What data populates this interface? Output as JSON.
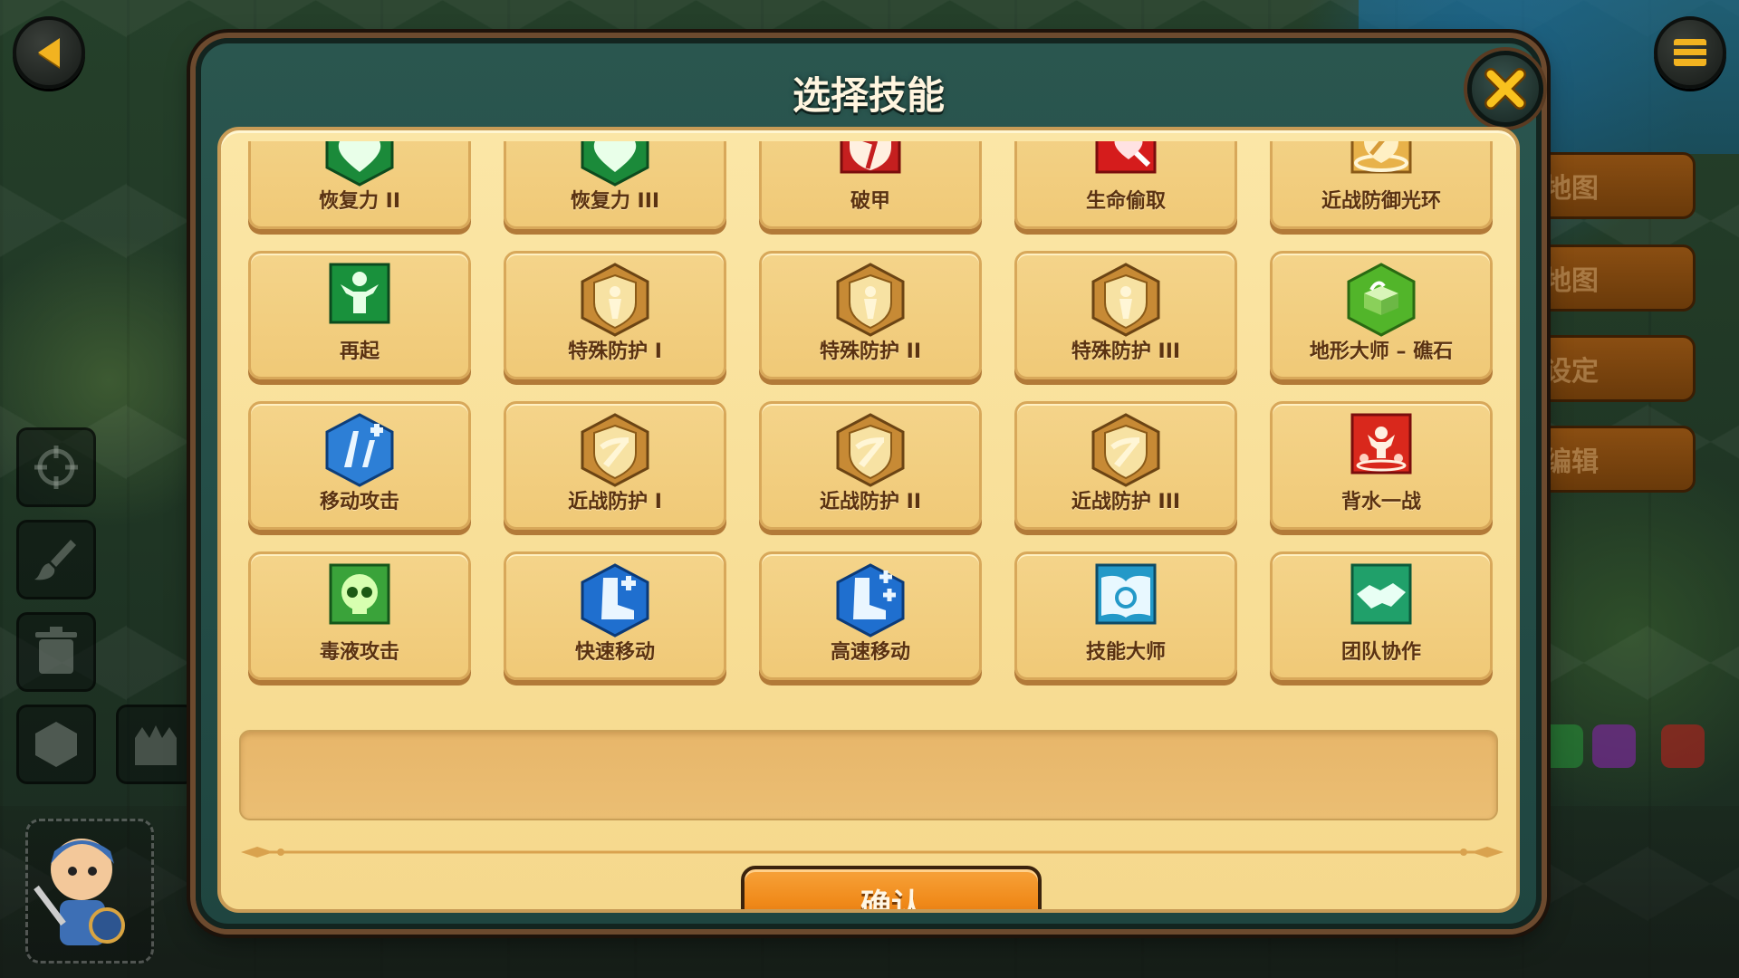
{
  "dialog": {
    "title": "选择技能",
    "confirm_label": "确认"
  },
  "skills": [
    {
      "label": "恢复力 II",
      "icon": "heart-plus-icon"
    },
    {
      "label": "恢复力 III",
      "icon": "heart-plus-icon"
    },
    {
      "label": "破甲",
      "icon": "broken-shield-icon"
    },
    {
      "label": "生命偷取",
      "icon": "life-steal-icon"
    },
    {
      "label": "近战防御光环",
      "icon": "melee-aura-icon"
    },
    {
      "label": "再起",
      "icon": "revive-icon"
    },
    {
      "label": "特殊防护 I",
      "icon": "special-shield-icon"
    },
    {
      "label": "特殊防护 II",
      "icon": "special-shield-icon"
    },
    {
      "label": "特殊防护 III",
      "icon": "special-shield-icon"
    },
    {
      "label": "地形大师 – 礁石",
      "icon": "terrain-reef-icon"
    },
    {
      "label": "移动攻击",
      "icon": "move-attack-icon"
    },
    {
      "label": "近战防护 I",
      "icon": "melee-shield-icon"
    },
    {
      "label": "近战防护 II",
      "icon": "melee-shield-icon"
    },
    {
      "label": "近战防护 III",
      "icon": "melee-shield-icon"
    },
    {
      "label": "背水一战",
      "icon": "last-stand-icon"
    },
    {
      "label": "毒液攻击",
      "icon": "poison-skull-icon"
    },
    {
      "label": "快速移动",
      "icon": "boot-plus-icon"
    },
    {
      "label": "高速移动",
      "icon": "boot-double-plus-icon"
    },
    {
      "label": "技能大师",
      "icon": "skill-book-icon"
    },
    {
      "label": "团队协作",
      "icon": "handshake-icon"
    }
  ],
  "background": {
    "right_tabs": [
      "地图",
      "地图",
      "设定",
      "编辑"
    ]
  },
  "colors": {
    "panel": "#f8de96",
    "tile": "#f0c977",
    "dialog_frame": "#2a564f",
    "confirm": "#f08a1a",
    "accent_gold": "#f2b320"
  }
}
